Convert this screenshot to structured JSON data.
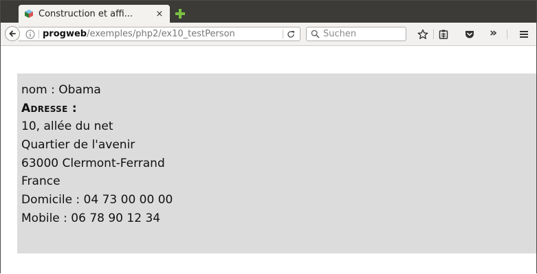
{
  "browser": {
    "tab": {
      "title": "Construction et affi...",
      "close": "×"
    },
    "url": {
      "host": "progweb",
      "path": "/exemples/php2/ex10_testPerson"
    },
    "search": {
      "placeholder": "Suchen"
    },
    "overflow_label": "»"
  },
  "page": {
    "lines": [
      "nom : Obama",
      "Adresse :",
      "10, allée du net",
      "Quartier de l'avenir",
      "63000 Clermont-Ferrand",
      "France",
      "Domicile : 04 73 00 00 00",
      "Mobile : 06 78 90 12 34"
    ]
  },
  "colors": {
    "tabbar": "#3c3b37",
    "content_background": "#dcdcdc",
    "newtab_plus": "#7bc142"
  }
}
